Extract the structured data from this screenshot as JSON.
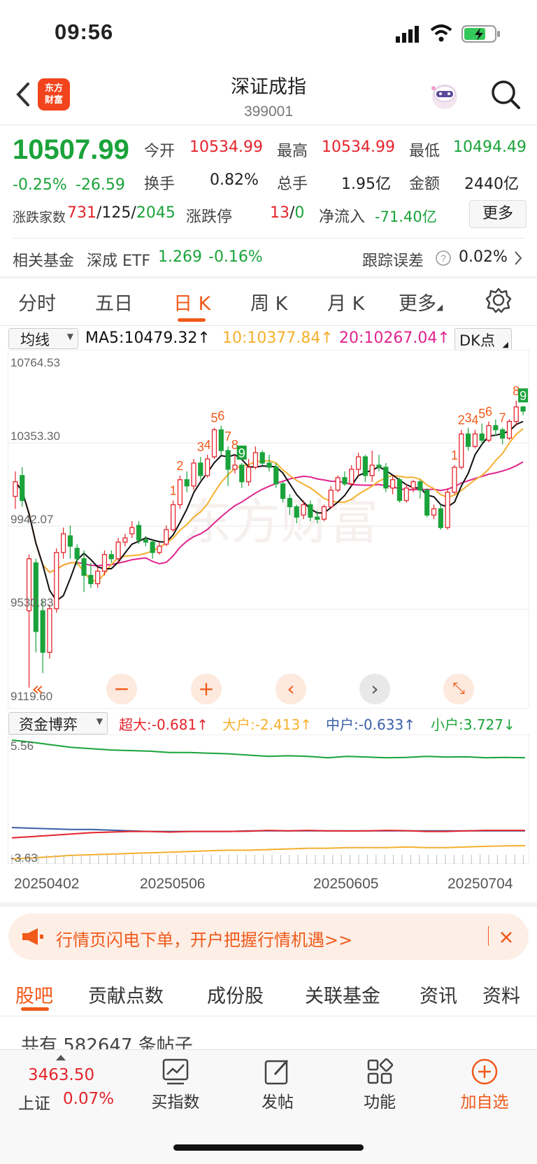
{
  "status": {
    "time": "09:56"
  },
  "header": {
    "logo_line1": "东方",
    "logo_line2": "财富",
    "title": "深证成指",
    "code": "399001"
  },
  "quote": {
    "price": "10507.99",
    "change_pct": "-0.25%",
    "change": "-26.59",
    "open_label": "今开",
    "open": "10534.99",
    "high_label": "最高",
    "high": "10534.99",
    "low_label": "最低",
    "low": "10494.49",
    "turnover_label": "换手",
    "turnover": "0.82%",
    "volume_label": "总手",
    "volume": "1.95亿",
    "amount_label": "金额",
    "amount": "2440亿",
    "breadth_label": "涨跌家数",
    "up": "731",
    "flat": "125",
    "down": "2045",
    "limit_label": "涨跌停",
    "limit_up": "13",
    "limit_down": "0",
    "inflow_label": "净流入",
    "inflow": "-71.40亿",
    "more": "更多"
  },
  "fund": {
    "label": "相关基金",
    "name": "深成 ETF",
    "price": "1.269",
    "change": "-0.16%",
    "track_label": "跟踪误差",
    "track": "0.02%"
  },
  "tabs": [
    "分时",
    "五日",
    "日 K",
    "周 K",
    "月 K",
    "更多"
  ],
  "ma": {
    "select": "均线",
    "ma5": "MA5:10479.32↑",
    "ma10": "10:10377.84↑",
    "ma20": "20:10267.04↑",
    "dk": "DK点"
  },
  "axis": {
    "y1": "10764.53",
    "y2": "10353.30",
    "y3": "9942.07",
    "y4": "9530.83",
    "y5": "9119.60"
  },
  "watermark": "东方财富",
  "flow": {
    "select": "资金博弈",
    "super": "超大:-0.681↑",
    "big": "大户:-2.413↑",
    "mid": "中户:-0.633↑",
    "small": "小户:3.727↓",
    "ytop": "5.56",
    "ybot": "-3.63"
  },
  "dates": [
    "20250402",
    "20250506",
    "20250605",
    "20250704"
  ],
  "banner": {
    "text": "行情页闪电下单，开户把握行情机遇>>"
  },
  "bottom_tabs": [
    "股吧",
    "贡献点数",
    "成份股",
    "关联基金",
    "资讯",
    "资料"
  ],
  "posts": "共有 582647 条帖子",
  "nav": {
    "index_value": "3463.50",
    "index_name": "上证",
    "index_change": "0.07%",
    "buy": "买指数",
    "post": "发帖",
    "func": "功能",
    "fav": "加自选"
  },
  "colors": {
    "up": "#e4242b",
    "down": "#1aa33a",
    "accent": "#f05a1a",
    "ma5": "#111111",
    "ma10": "#f5b02e",
    "ma20": "#e0248c"
  },
  "chart_data": {
    "type": "candlestick",
    "ylim": [
      9119.6,
      10764.53
    ],
    "candles": [
      [
        10100,
        10170,
        10040,
        10220
      ],
      [
        10200,
        10080,
        10050,
        10240
      ],
      [
        9550,
        9800,
        9180,
        9820
      ],
      [
        9780,
        9450,
        9350,
        9800
      ],
      [
        9550,
        9350,
        9250,
        9600
      ],
      [
        9350,
        9560,
        9320,
        9580
      ],
      [
        9560,
        9830,
        9540,
        9850
      ],
      [
        9830,
        9920,
        9800,
        9950
      ],
      [
        9910,
        9860,
        9800,
        9960
      ],
      [
        9850,
        9800,
        9770,
        9870
      ],
      [
        9800,
        9720,
        9640,
        9840
      ],
      [
        9720,
        9680,
        9660,
        9780
      ],
      [
        9680,
        9740,
        9660,
        9760
      ],
      [
        9740,
        9820,
        9720,
        9840
      ],
      [
        9820,
        9800,
        9780,
        9840
      ],
      [
        9800,
        9880,
        9780,
        9900
      ],
      [
        9880,
        9900,
        9860,
        9920
      ],
      [
        9920,
        9950,
        9900,
        9980
      ],
      [
        9960,
        9890,
        9870,
        9980
      ],
      [
        9890,
        9880,
        9860,
        9910
      ],
      [
        9880,
        9830,
        9800,
        9890
      ],
      [
        9830,
        9860,
        9820,
        9880
      ],
      [
        9870,
        9940,
        9860,
        9960
      ],
      [
        9940,
        10060,
        9930,
        10080
      ],
      [
        10060,
        10180,
        10040,
        10200
      ],
      [
        10180,
        10150,
        10120,
        10220
      ],
      [
        10150,
        10260,
        10130,
        10280
      ],
      [
        10260,
        10200,
        10180,
        10290
      ],
      [
        10200,
        10280,
        10190,
        10300
      ],
      [
        10290,
        10420,
        10280,
        10430
      ],
      [
        10420,
        10320,
        10300,
        10440
      ],
      [
        10320,
        10230,
        10150,
        10340
      ],
      [
        10230,
        10250,
        10210,
        10300
      ],
      [
        10250,
        10170,
        10140,
        10260
      ],
      [
        10170,
        10240,
        10150,
        10280
      ],
      [
        10240,
        10310,
        10230,
        10340
      ],
      [
        10310,
        10260,
        10250,
        10320
      ],
      [
        10260,
        10240,
        10220,
        10300
      ],
      [
        10240,
        10160,
        10140,
        10260
      ],
      [
        10160,
        10090,
        10070,
        10170
      ],
      [
        10090,
        10050,
        10010,
        10110
      ],
      [
        10050,
        10000,
        9970,
        10060
      ],
      [
        10010,
        10060,
        9990,
        10080
      ],
      [
        10060,
        10000,
        9980,
        10080
      ],
      [
        10000,
        9990,
        9970,
        10030
      ],
      [
        9990,
        10050,
        9980,
        10060
      ],
      [
        10050,
        10130,
        10040,
        10150
      ],
      [
        10130,
        10190,
        10120,
        10200
      ],
      [
        10190,
        10160,
        10150,
        10220
      ],
      [
        10160,
        10230,
        10150,
        10250
      ],
      [
        10230,
        10290,
        10200,
        10310
      ],
      [
        10290,
        10200,
        10170,
        10300
      ],
      [
        10200,
        10250,
        10170,
        10320
      ],
      [
        10250,
        10240,
        10220,
        10300
      ],
      [
        10240,
        10140,
        10120,
        10260
      ],
      [
        10140,
        10180,
        10110,
        10200
      ],
      [
        10180,
        10080,
        10070,
        10190
      ],
      [
        10080,
        10140,
        10070,
        10160
      ],
      [
        10140,
        10170,
        10120,
        10180
      ],
      [
        10170,
        10130,
        10090,
        10180
      ],
      [
        10130,
        10010,
        10000,
        10140
      ],
      [
        10010,
        10040,
        9990,
        10060
      ],
      [
        10040,
        9950,
        9940,
        10060
      ],
      [
        9950,
        10120,
        9940,
        10140
      ],
      [
        10120,
        10240,
        10110,
        10250
      ],
      [
        10240,
        10400,
        10230,
        10420
      ],
      [
        10400,
        10340,
        10320,
        10430
      ],
      [
        10340,
        10400,
        10330,
        10420
      ],
      [
        10400,
        10370,
        10350,
        10450
      ],
      [
        10370,
        10440,
        10360,
        10460
      ],
      [
        10440,
        10420,
        10390,
        10470
      ],
      [
        10420,
        10380,
        10350,
        10430
      ],
      [
        10380,
        10460,
        10370,
        10470
      ],
      [
        10460,
        10530,
        10440,
        10560
      ],
      [
        10530,
        10510,
        10490,
        10535
      ]
    ],
    "labels": [
      {
        "i": 23,
        "text": "1"
      },
      {
        "i": 24,
        "text": "2"
      },
      {
        "i": 27,
        "text": "3"
      },
      {
        "i": 28,
        "text": "4"
      },
      {
        "i": 29,
        "text": "5"
      },
      {
        "i": 30,
        "text": "6"
      },
      {
        "i": 31,
        "text": "7"
      },
      {
        "i": 32,
        "text": "8"
      },
      {
        "i": 33,
        "text": "9",
        "boxed": true
      },
      {
        "i": 64,
        "text": "1"
      },
      {
        "i": 65,
        "text": "2"
      },
      {
        "i": 66,
        "text": "3"
      },
      {
        "i": 67,
        "text": "4"
      },
      {
        "i": 68,
        "text": "5"
      },
      {
        "i": 69,
        "text": "6"
      },
      {
        "i": 71,
        "text": "7"
      },
      {
        "i": 73,
        "text": "8"
      },
      {
        "i": 74,
        "text": "9",
        "boxed": true
      }
    ],
    "flow_ylim": [
      -3.63,
      5.56
    ],
    "flow_series": [
      {
        "color": "#1aa33a",
        "values": [
          5.56,
          5.4,
          5.2,
          5.0,
          4.9,
          4.8,
          4.75,
          4.7,
          4.6,
          4.6,
          4.55,
          4.5,
          4.4,
          4.3,
          4.35,
          4.3,
          4.2,
          4.3,
          4.25,
          4.2,
          4.22,
          4.3,
          4.25,
          4.27,
          4.2,
          4.22,
          4.2
        ]
      },
      {
        "color": "#3a5fa6",
        "values": [
          -1.2,
          -1.25,
          -1.3,
          -1.35,
          -1.35,
          -1.4,
          -1.45,
          -1.5,
          -1.5,
          -1.5,
          -1.5,
          -1.5,
          -1.45,
          -1.45,
          -1.45,
          -1.45,
          -1.45,
          -1.45,
          -1.45,
          -1.45,
          -1.45,
          -1.45,
          -1.45,
          -1.45,
          -1.45,
          -1.45,
          -1.45
        ]
      },
      {
        "color": "#e4242b",
        "values": [
          -2.0,
          -1.9,
          -1.8,
          -1.7,
          -1.6,
          -1.55,
          -1.5,
          -1.5,
          -1.55,
          -1.5,
          -1.5,
          -1.5,
          -1.48,
          -1.42,
          -1.45,
          -1.42,
          -1.45,
          -1.46,
          -1.45,
          -1.42,
          -1.44,
          -1.5,
          -1.5,
          -1.45,
          -1.42,
          -1.42,
          -1.42
        ]
      },
      {
        "color": "#f5b02e",
        "values": [
          -3.63,
          -3.55,
          -3.45,
          -3.35,
          -3.3,
          -3.25,
          -3.2,
          -3.15,
          -3.1,
          -3.05,
          -3.0,
          -2.95,
          -2.95,
          -2.9,
          -2.85,
          -2.8,
          -2.8,
          -2.75,
          -2.75,
          -2.75,
          -2.7,
          -2.75,
          -2.75,
          -2.7,
          -2.65,
          -2.62,
          -2.6
        ]
      }
    ]
  }
}
